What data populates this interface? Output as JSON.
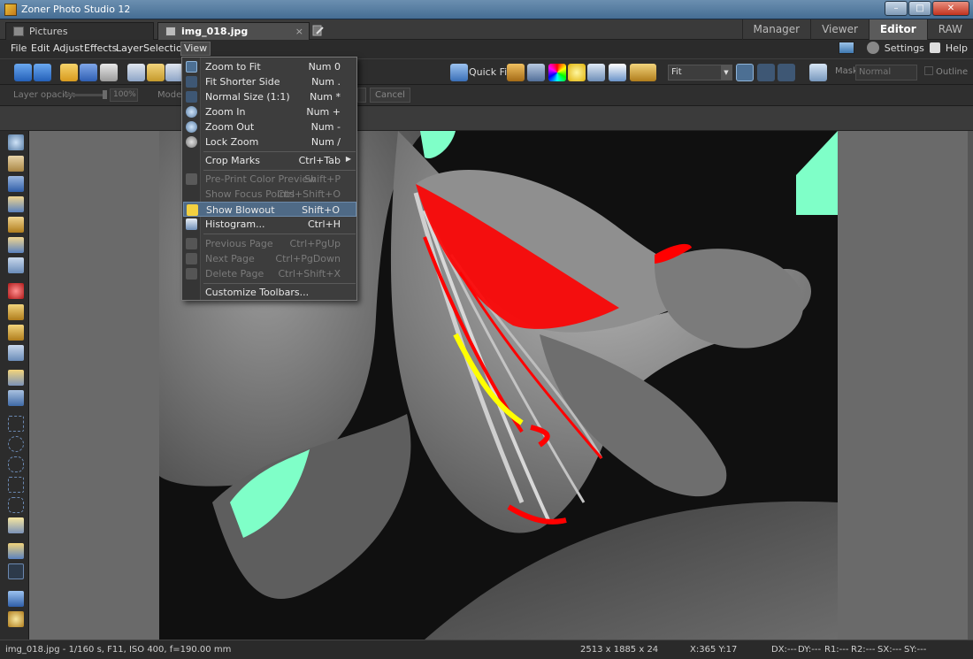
{
  "window": {
    "title": "Zoner Photo Studio 12",
    "controls": [
      "–",
      "□",
      "✕"
    ]
  },
  "tabs": {
    "pictures": "Pictures",
    "document": "img_018.jpg",
    "document_close": "×",
    "modes": [
      "Manager",
      "Viewer",
      "Editor",
      "RAW"
    ],
    "active_mode": "Editor"
  },
  "menubar": {
    "items": [
      "File",
      "Edit",
      "Adjust",
      "Effects",
      "Layer",
      "Selection",
      "View"
    ],
    "settings": "Settings",
    "help": "Help"
  },
  "toolbar": {
    "quick_fix": "Quick Fix",
    "zoom_select": "Fit",
    "mask_label": "Mask:",
    "mask_select": "Normal",
    "outline": "Outline"
  },
  "options": {
    "layer_opacity_label": "Layer opacity:",
    "opacity_value": "100%",
    "mode_label": "Mode:",
    "cancel": "Cancel",
    "layer_opacity_percent": 100
  },
  "view_menu": {
    "items": [
      {
        "label": "Zoom to Fit",
        "shortcut": "Num 0",
        "enabled": true
      },
      {
        "label": "Fit Shorter Side",
        "shortcut": "Num .",
        "enabled": true
      },
      {
        "label": "Normal Size (1:1)",
        "shortcut": "Num *",
        "enabled": true
      },
      {
        "label": "Zoom In",
        "shortcut": "Num +",
        "enabled": true
      },
      {
        "label": "Zoom Out",
        "shortcut": "Num -",
        "enabled": true
      },
      {
        "label": "Lock Zoom",
        "shortcut": "Num /",
        "enabled": true
      },
      {
        "label": "Crop Marks",
        "shortcut": "Ctrl+Tab",
        "enabled": true,
        "submenu": true
      },
      {
        "label": "Pre-Print Color Preview",
        "shortcut": "Shift+P",
        "enabled": false
      },
      {
        "label": "Show Focus Points",
        "shortcut": "Ctrl+Shift+O",
        "enabled": false
      },
      {
        "label": "Show Blowout",
        "shortcut": "Shift+O",
        "enabled": true,
        "highlighted": true
      },
      {
        "label": "Histogram...",
        "shortcut": "Ctrl+H",
        "enabled": true
      },
      {
        "label": "Previous Page",
        "shortcut": "Ctrl+PgUp",
        "enabled": false
      },
      {
        "label": "Next Page",
        "shortcut": "Ctrl+PgDown",
        "enabled": false
      },
      {
        "label": "Delete Page",
        "shortcut": "Ctrl+Shift+X",
        "enabled": false
      },
      {
        "label": "Customize Toolbars...",
        "shortcut": "",
        "enabled": true
      }
    ]
  },
  "statusbar": {
    "file_info": "img_018.jpg - 1/160 s, F11, ISO 400, f=190.00 mm",
    "dimensions": "2513 x 1885 x 24",
    "cursor": "X:365  Y:17",
    "dx": "DX:---",
    "dy": "DY:---",
    "r1": "R1:---",
    "r2": "R2:---",
    "sx": "SX:---",
    "sy": "SY:---"
  },
  "colors": {
    "blowout_red": "#ff0000",
    "blowout_yellow": "#ffff00",
    "blowout_cyan": "#7fffc8",
    "menu_highlight": "#4f6a86"
  }
}
